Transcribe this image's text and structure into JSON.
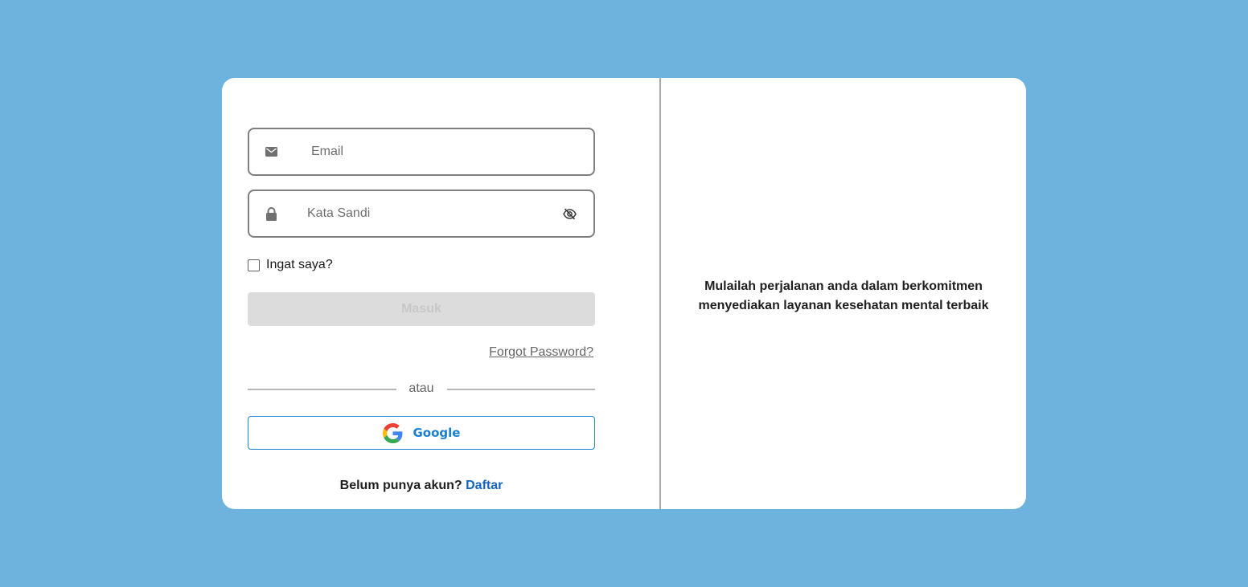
{
  "login": {
    "email_placeholder": "Email",
    "password_placeholder": "Kata Sandi",
    "remember_label": "Ingat saya?",
    "submit_label": "Masuk",
    "forgot_label": "Forgot Password?",
    "divider_text": "atau",
    "google_label": "Google",
    "signup_prompt": "Belum punya akun?",
    "signup_link": "Daftar"
  },
  "hero": {
    "tagline": "Mulailah perjalanan anda dalam berkomitmen menyediakan layanan kesehatan mental terbaik"
  },
  "icons": {
    "email": "mail-icon",
    "password": "lock-icon",
    "toggle": "eye-off-icon",
    "google": "google-logo-icon"
  },
  "colors": {
    "background": "#6db3de",
    "card": "#ffffff",
    "link": "#1565c0",
    "google_accent": "#1a7fd0",
    "disabled_button": "#dcdcdc"
  }
}
